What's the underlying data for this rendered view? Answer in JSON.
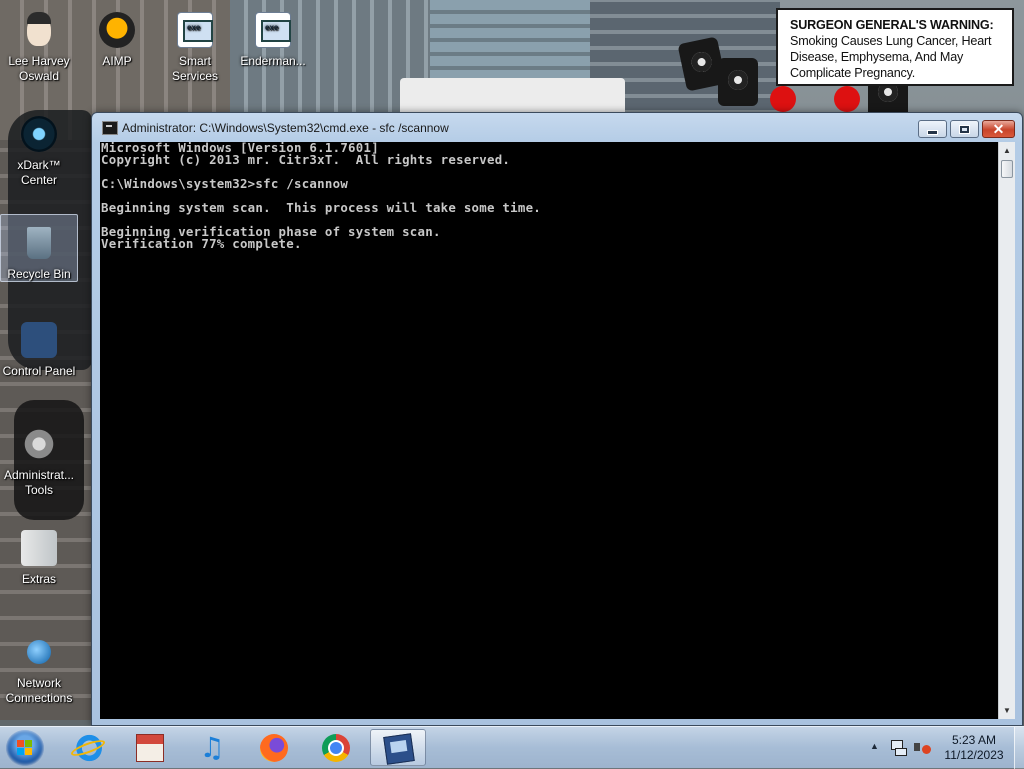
{
  "warning": {
    "heading": "SURGEON GENERAL'S WARNING:",
    "text": "Smoking Causes Lung Cancer, Heart Disease, Emphysema, And May Complicate Pregnancy."
  },
  "desktop_icons": [
    {
      "label": "Lee Harvey Oswald",
      "icon": "person-icon"
    },
    {
      "label": "AIMP",
      "icon": "aimp-icon"
    },
    {
      "label": "Smart Services",
      "icon": "exe-icon"
    },
    {
      "label": "Enderman...",
      "icon": "exe-icon"
    },
    {
      "label": "xDark™ Center",
      "icon": "xdark-icon"
    },
    {
      "label": "Recycle Bin",
      "icon": "recycle-bin-icon"
    },
    {
      "label": "Control Panel",
      "icon": "control-panel-icon"
    },
    {
      "label": "Administrat... Tools",
      "icon": "admin-tools-icon"
    },
    {
      "label": "Extras",
      "icon": "folder-icon"
    },
    {
      "label": "Network Connections",
      "icon": "network-icon"
    }
  ],
  "window": {
    "title": "Administrator: C:\\Windows\\System32\\cmd.exe - sfc  /scannow",
    "minimize": "minimize",
    "maximize": "maximize",
    "close": "✕"
  },
  "console": {
    "lines": [
      "Microsoft Windows [Version 6.1.7601]",
      "Copyright (c) 2013 mr. Citr3xT.  All rights reserved.",
      "",
      "C:\\Windows\\system32>sfc /scannow",
      "",
      "Beginning system scan.  This process will take some time.",
      "",
      "Beginning verification phase of system scan.",
      "Verification 77% complete."
    ]
  },
  "taskbar": {
    "apps": [
      {
        "name": "internet-explorer",
        "icon": "ie-icon",
        "active": false
      },
      {
        "name": "store",
        "icon": "store-icon",
        "active": false
      },
      {
        "name": "music",
        "icon": "music-note-icon",
        "active": false
      },
      {
        "name": "firefox",
        "icon": "firefox-icon",
        "active": false
      },
      {
        "name": "chrome",
        "icon": "chrome-icon",
        "active": false
      },
      {
        "name": "command-prompt",
        "icon": "cmd-icon",
        "active": true
      }
    ],
    "clock": {
      "time": "5:23 AM",
      "date": "11/12/2023"
    }
  }
}
